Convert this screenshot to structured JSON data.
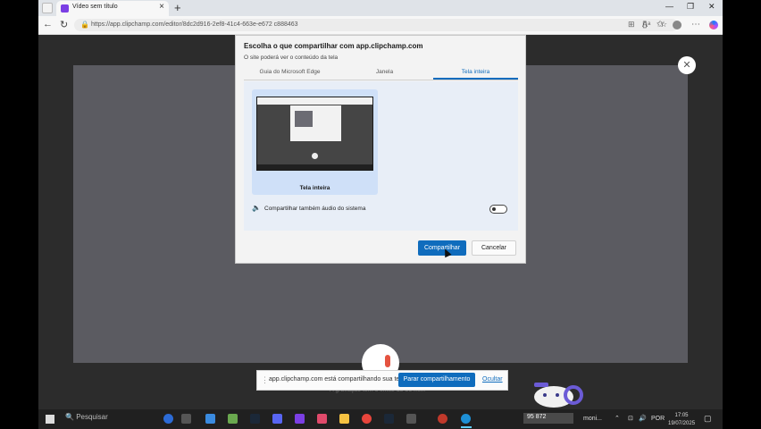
{
  "browser": {
    "tab_title": "Vídeo sem título",
    "new_tab": "+",
    "url": "https://app.clipchamp.com/editor/8dc2d916-2ef8-41c4-663e-e672 c888463"
  },
  "dialog": {
    "title": "Escolha o que compartilhar com app.clipchamp.com",
    "subtitle": "O site poderá ver o conteúdo da tela",
    "tabs": [
      "Guia do Microsoft Edge",
      "Janela",
      "Tela inteira"
    ],
    "active_tab": "Tela inteira",
    "thumbnail_label": "Tela inteira",
    "audio_label": "Compartilhar também áudio do sistema",
    "audio_enabled": false,
    "share_button": "Compartilhar",
    "cancel_button": "Cancelar"
  },
  "sharebar": {
    "text": "app.clipchamp.com está compartilhando sua tela",
    "stop_button": "Parar compartilhamento",
    "hide_link": "Ocultar"
  },
  "recorder": {
    "notice": "A gravação tem o limite de 30 min."
  },
  "taskbar": {
    "search": "Pesquisar",
    "widget_value": "95 872",
    "widget_suffix": "moni...",
    "language": "POR",
    "time": "17:05",
    "date": "19/07/2025"
  }
}
